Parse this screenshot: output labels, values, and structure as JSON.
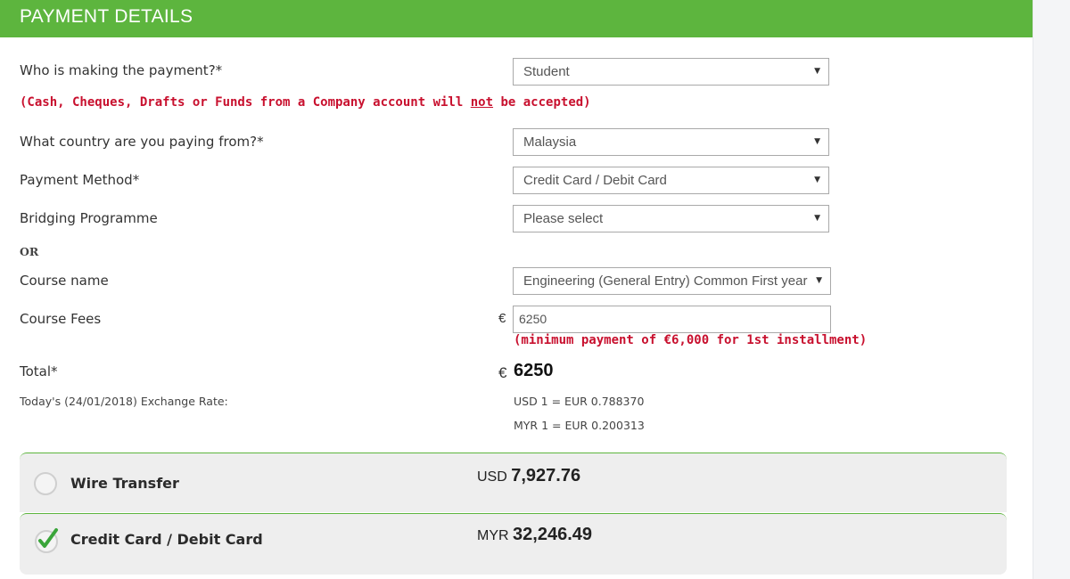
{
  "header": {
    "title": "PAYMENT DETAILS"
  },
  "form": {
    "payer": {
      "label": "Who is making the payment?*",
      "value": "Student"
    },
    "warning": {
      "prefix": "(Cash, Cheques, Drafts or Funds from a Company account will ",
      "emphasis": "not",
      "suffix": " be accepted)"
    },
    "country": {
      "label": "What country are you paying from?*",
      "value": "Malaysia"
    },
    "method": {
      "label": "Payment Method*",
      "value": "Credit Card / Debit Card"
    },
    "bridging": {
      "label": "Bridging Programme",
      "value": "Please select"
    },
    "or_label": "OR",
    "course": {
      "label": "Course name",
      "value": "Engineering (General Entry) Common First year"
    },
    "fees": {
      "label": "Course Fees",
      "currency_symbol": "€",
      "value": "6250",
      "note": "(minimum payment of €6,000 for 1st installment)"
    },
    "total": {
      "label": "Total*",
      "currency_symbol": "€",
      "amount": "6250"
    },
    "exchange": {
      "label": "Today's (24/01/2018) Exchange Rate:",
      "usd": "USD 1 = EUR 0.788370",
      "myr": "MYR 1 = EUR 0.200313"
    }
  },
  "payment_options": [
    {
      "label": "Wire Transfer",
      "currency": "USD",
      "amount": "7,927.76",
      "selected": false
    },
    {
      "label": "Credit Card / Debit Card",
      "currency": "MYR",
      "amount": "32,246.49",
      "selected": true
    }
  ],
  "colors": {
    "brand_green": "#5db53e",
    "warning_red": "#c8102e",
    "option_bg": "#eeeeee"
  },
  "icons": {
    "select_caret": "caret-down-icon",
    "selected_option": "checkmark-icon"
  }
}
